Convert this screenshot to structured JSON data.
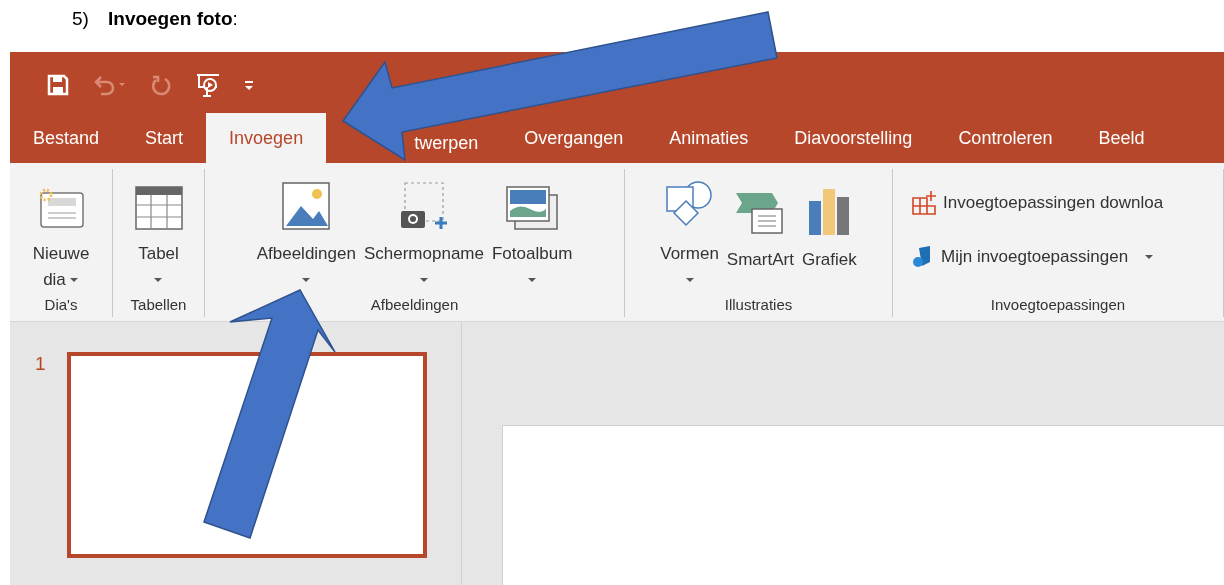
{
  "heading": {
    "number": "5)",
    "text": "**Invoegen foto**:"
  },
  "quick_access": [
    {
      "kind": "save",
      "disabled": false
    },
    {
      "kind": "undo",
      "disabled": true
    },
    {
      "kind": "redo",
      "disabled": true
    },
    {
      "kind": "present",
      "disabled": false
    },
    {
      "kind": "customize",
      "disabled": false
    }
  ],
  "tabs": [
    {
      "label": "Bestand",
      "selected": false
    },
    {
      "label": "Start",
      "selected": false
    },
    {
      "label": "Invoegen",
      "selected": true
    },
    {
      "label": "twerpen",
      "selected": false
    },
    {
      "label": "Overgangen",
      "selected": false
    },
    {
      "label": "Animaties",
      "selected": false
    },
    {
      "label": "Diavoorstelling",
      "selected": false
    },
    {
      "label": "Controleren",
      "selected": false
    },
    {
      "label": "Beeld",
      "selected": false
    }
  ],
  "ribbon_groups": [
    {
      "label": "Dia's",
      "buttons": [
        {
          "kind": "large",
          "lines": [
            "Nieuwe",
            "dia"
          ],
          "dropdown": true
        }
      ]
    },
    {
      "label": "Tabellen",
      "buttons": [
        {
          "kind": "large",
          "lines": [
            "Tabel"
          ],
          "dropdown": true
        }
      ]
    },
    {
      "label": "Afbeeldingen",
      "buttons": [
        {
          "kind": "large",
          "lines": [
            "Afbeeldingen"
          ],
          "dropdown": true
        },
        {
          "kind": "large",
          "lines": [
            "Schermopname"
          ],
          "dropdown": true
        },
        {
          "kind": "large",
          "lines": [
            "Fotoalbum"
          ],
          "dropdown": true
        }
      ]
    },
    {
      "label": "Illustraties",
      "buttons": [
        {
          "kind": "large",
          "lines": [
            "Vormen"
          ],
          "dropdown": true
        },
        {
          "kind": "large",
          "lines": [
            "SmartArt"
          ],
          "dropdown": false
        },
        {
          "kind": "large",
          "lines": [
            "Grafiek"
          ],
          "dropdown": false
        }
      ]
    },
    {
      "label": "Invoegtoepassingen",
      "buttons": [
        {
          "kind": "small",
          "lines": [
            "Invoegtoepassingen downloa"
          ],
          "dropdown": false
        },
        {
          "kind": "small",
          "lines": [
            "Mijn invoegtoepassingen"
          ],
          "dropdown": true
        }
      ]
    }
  ],
  "slides": [
    {
      "number": "1",
      "selected": true
    }
  ]
}
